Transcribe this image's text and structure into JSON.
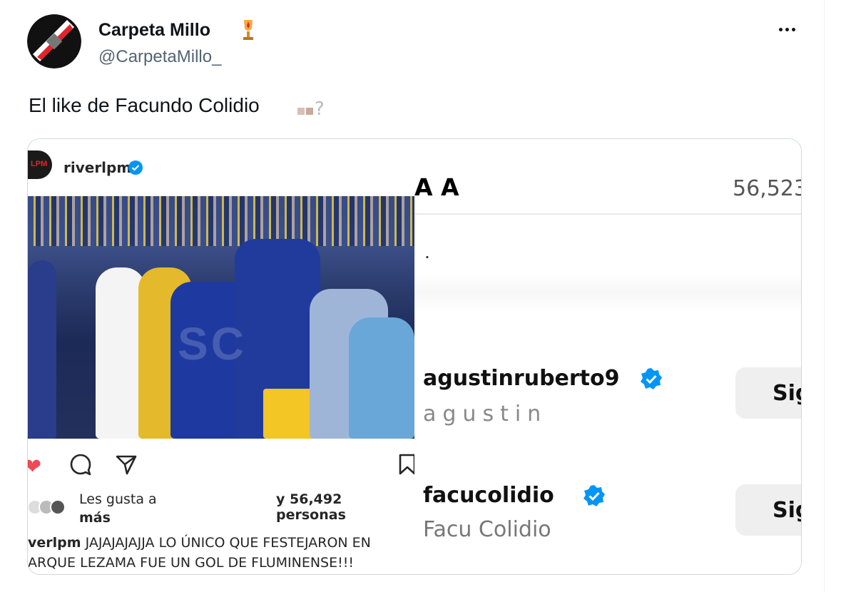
{
  "tweet": {
    "author_name": "Carpeta Millo",
    "author_handle": "@CarpetaMillo_",
    "text": "El like de Facundo Colidio",
    "more_label": "More",
    "icons": {
      "avatar": "river-plate-avatar",
      "name_emoji": "trophy-emoji",
      "text_emoji": "eyes-question-emoji",
      "more": "more-dots-icon"
    }
  },
  "instagram_post": {
    "username": "riverlpm",
    "avatar_text": "LPM",
    "video_watermark": "SC",
    "likes_prefix": "Les gusta a",
    "likes_suffix": "y 56,492 personas",
    "likes_more": "más",
    "caption_user": "verlpm",
    "caption_line1": "JAJAJAJAJJA LO ÚNICO QUE FESTEJARON EN",
    "caption_line2": "ARQUE LEZAMA FUE UN GOL DE FLUMINENSE!!!",
    "icons": [
      "heart-icon",
      "comment-icon",
      "share-icon",
      "save-icon",
      "verified-icon"
    ],
    "liked": true
  },
  "likes_list": {
    "title": "A A",
    "count": "56,523",
    "users": [
      {
        "username": "agustinruberto9",
        "name": "agustin",
        "verified": true,
        "button": "Sig"
      },
      {
        "username": "facucolidio",
        "name": "Facu Colidio",
        "verified": true,
        "button": "Sig"
      }
    ]
  },
  "colors": {
    "accent": "#1d9bf0",
    "like": "#ed4956",
    "ig_verified": "#0095f6",
    "river_red": "#e5222b"
  }
}
